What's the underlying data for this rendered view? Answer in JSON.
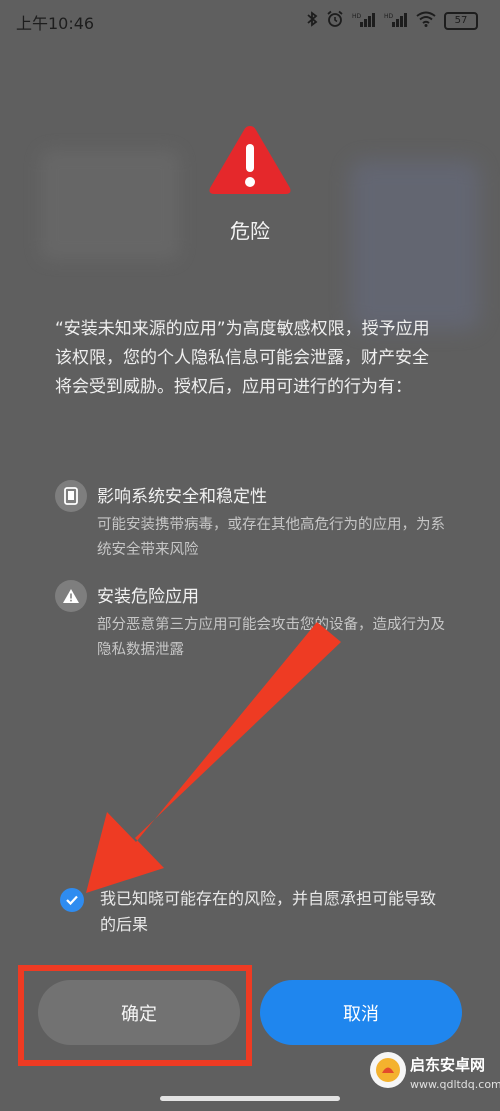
{
  "status_bar": {
    "time": "上午10:46",
    "signal_1": "HD",
    "signal_2": "HD",
    "battery": "57",
    "icons": [
      "bluetooth-icon",
      "alarm-icon",
      "signal-icon",
      "signal-icon",
      "wifi-icon",
      "battery-icon"
    ]
  },
  "dialog": {
    "title": "危险",
    "intro": "“安装未知来源的应用”为高度敏感权限，授予应用该权限，您的个人隐私信息可能会泄露，财产安全将会受到威胁。授权后，应用可进行的行为有：",
    "risks": [
      {
        "icon": "phone-icon",
        "title": "影响系统安全和稳定性",
        "description": "可能安装携带病毒，或存在其他高危行为的应用，为系统安全带来风险"
      },
      {
        "icon": "warning-icon",
        "title": "安装危险应用",
        "description": "部分恶意第三方应用可能会攻击您的设备，造成行为及隐私数据泄露"
      }
    ],
    "consent": {
      "checked": true,
      "label": "我已知晓可能存在的风险，并自愿承担可能导致的后果"
    },
    "buttons": {
      "confirm": "确定",
      "cancel": "取消"
    }
  },
  "annotations": {
    "arrow_color": "#ee3b23",
    "box_color": "#ee3b23"
  },
  "watermark": {
    "brand": "启东安卓网",
    "url": "www.qdltdq.com"
  },
  "colors": {
    "overlay_bg": "#5f5f5f",
    "danger_red": "#e5282b",
    "primary_blue": "#1f86ee"
  }
}
